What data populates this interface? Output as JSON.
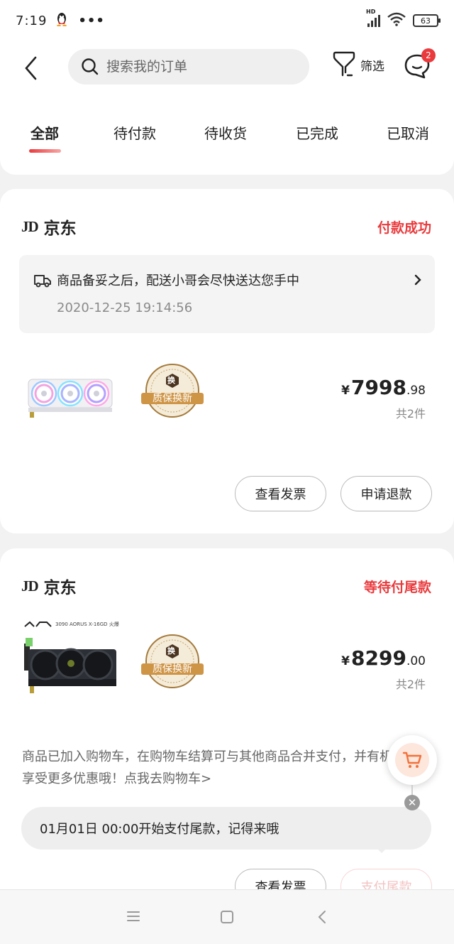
{
  "status_bar": {
    "time": "7:19",
    "more": "•••",
    "network": "HD",
    "battery": "63"
  },
  "header": {
    "search_placeholder": "搜索我的订单",
    "filter_label": "筛选",
    "message_badge": "2"
  },
  "tabs": [
    {
      "label": "全部",
      "active": true
    },
    {
      "label": "待付款",
      "active": false
    },
    {
      "label": "待收货",
      "active": false
    },
    {
      "label": "已完成",
      "active": false
    },
    {
      "label": "已取消",
      "active": false
    }
  ],
  "orders": [
    {
      "shop_logo": "JD",
      "shop_name": "京东",
      "status": "付款成功",
      "delivery_text": "商品备妥之后，配送小哥会尽快送达您手中",
      "delivery_time": "2020-12-25  19:14:56",
      "warranty_label": "质保换新",
      "warranty_badge": "换",
      "currency": "¥",
      "price_int": "7998",
      "price_dec": ".98",
      "count": "共2件",
      "buttons": [
        "查看发票",
        "申请退款"
      ]
    },
    {
      "shop_logo": "JD",
      "shop_name": "京东",
      "status": "等待付尾款",
      "product_caption": "3090 AORUS X-16GD 火爆",
      "warranty_label": "质保换新",
      "warranty_badge": "换",
      "currency": "¥",
      "price_int": "8299",
      "price_dec": ".00",
      "count": "共2件",
      "cart_tip": "商品已加入购物车，在购物车结算可与其他商品合并支付，并有机会享受更多优惠哦！点我去购物车>",
      "notice": "01月01日 00:00开始支付尾款，记得来哦",
      "buttons": [
        "查看发票",
        "支付尾款"
      ]
    }
  ],
  "float": {
    "close": "✕"
  }
}
